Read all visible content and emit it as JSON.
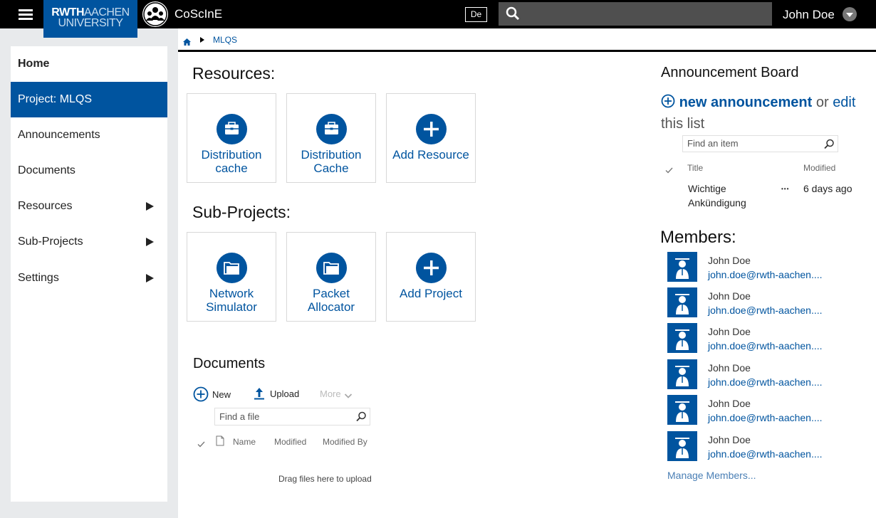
{
  "header": {
    "logo_line1_bold": "RWTH",
    "logo_line1_thin": "AACHEN",
    "logo_line2": "UNIVERSITY",
    "app_name": "CoScInE",
    "language": "De",
    "search_placeholder": "",
    "user_name": "John Doe"
  },
  "sidebar": {
    "items": [
      {
        "label": "Home"
      },
      {
        "label": "Project: MLQS"
      },
      {
        "label": "Announcements"
      },
      {
        "label": "Documents"
      },
      {
        "label": "Resources"
      },
      {
        "label": "Sub-Projects"
      },
      {
        "label": "Settings"
      }
    ]
  },
  "breadcrumb": {
    "current": "MLQS"
  },
  "resources": {
    "title": "Resources:",
    "tiles": [
      {
        "label_line1": "Distribution",
        "label_line2": "cache",
        "icon": "briefcase-icon"
      },
      {
        "label_line1": "Distribution",
        "label_line2": "Cache",
        "icon": "briefcase-icon"
      },
      {
        "label_line1": "Add Resource",
        "label_line2": "",
        "icon": "plus-icon"
      }
    ]
  },
  "subprojects": {
    "title": "Sub-Projects:",
    "tiles": [
      {
        "label_line1": "Network",
        "label_line2": "Simulator",
        "icon": "folder-icon"
      },
      {
        "label_line1": "Packet",
        "label_line2": "Allocator",
        "icon": "folder-icon"
      },
      {
        "label_line1": "Add Project",
        "label_line2": "",
        "icon": "plus-icon"
      }
    ]
  },
  "documents": {
    "title": "Documents",
    "new_label": "New",
    "upload_label": "Upload",
    "more_label": "More",
    "find_placeholder": "Find a file",
    "columns": {
      "name": "Name",
      "modified": "Modified",
      "modified_by": "Modified By"
    },
    "drag_text": "Drag files here to upload"
  },
  "announcements": {
    "title": "Announcement Board",
    "new_link": "new announcement",
    "or_text": "or",
    "edit_link": "edit",
    "edit_suffix": "this list",
    "find_placeholder": "Find an item",
    "col_title": "Title",
    "col_modified": "Modified",
    "rows": [
      {
        "title_line1": "Wichtige",
        "title_line2": "Ankündigung",
        "dots": "•••",
        "modified": "6 days ago"
      }
    ]
  },
  "members": {
    "title": "Members:",
    "list": [
      {
        "name": "John Doe",
        "email": "john.doe@rwth-aachen...."
      },
      {
        "name": "John Doe",
        "email": "john.doe@rwth-aachen...."
      },
      {
        "name": "John Doe",
        "email": "john.doe@rwth-aachen...."
      },
      {
        "name": "John Doe",
        "email": "john.doe@rwth-aachen...."
      },
      {
        "name": "John Doe",
        "email": "john.doe@rwth-aachen...."
      },
      {
        "name": "John Doe",
        "email": "john.doe@rwth-aachen...."
      }
    ],
    "manage_link": "Manage Members..."
  },
  "colors": {
    "brand_blue": "#00549f",
    "topbar": "#000000",
    "sidebar_bg": "#e8eaec"
  }
}
